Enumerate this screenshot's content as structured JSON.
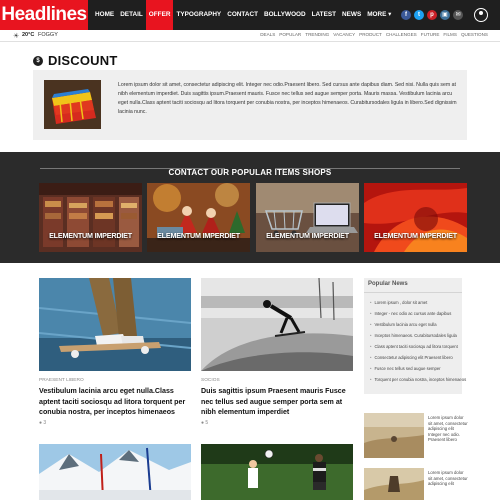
{
  "header": {
    "logo": "Headlines",
    "nav": [
      "HOME",
      "DETAIL",
      "OFFER",
      "TYPOGRAPHY",
      "CONTACT",
      "BOLLYWOOD",
      "LATEST",
      "NEWS",
      "MORE ▾"
    ],
    "active_nav": "OFFER",
    "social": [
      {
        "name": "facebook-icon",
        "glyph": "f",
        "color": "#3b5998"
      },
      {
        "name": "twitter-icon",
        "glyph": "t",
        "color": "#1da1f2"
      },
      {
        "name": "pinterest-icon",
        "glyph": "p",
        "color": "#cb2027"
      },
      {
        "name": "instagram-icon",
        "glyph": "▣",
        "color": "#3f729b"
      },
      {
        "name": "email-icon",
        "glyph": "✉",
        "color": "#555555"
      }
    ]
  },
  "subbar": {
    "temperature": "20°C",
    "condition": "FOGGY",
    "tags": [
      "DEALS",
      "POPULAR",
      "TRENDING",
      "VACANCY",
      "PRODUCT",
      "CHALLENGES",
      "FUTURE",
      "FILMS",
      "QUESTIONS"
    ]
  },
  "discount": {
    "title": "DISCOUNT",
    "text": "Lorem ipsum dolor sit amet, consectetur adipiscing elit. Integer nec odio.Praesent libero. Sed cursus ante dapibus diam. Sed nisi. Nulla quis sem at nibh elementum imperdiet. Duis sagittis ipsum.Praesent mauris. Fusce nec tellus sed augue semper porta. Mauris massa. Vestibulum lacinia arcu eget nulla.Class aptent taciti sociosqu ad litora torquent per conubia nostra, per inceptos himenaeos. Curabitursodales ligula in libero.Sed dignissim lacinia nunc."
  },
  "shops": {
    "title": "CONTACT OUR POPULAR ITEMS SHOPS",
    "cards": [
      "ELEMENTUM IMPERDIET",
      "ELEMENTUM IMPERDIET",
      "ELEMENTUM IMPERDIET",
      "ELEMENTUM IMPERDIET"
    ]
  },
  "posts": [
    {
      "category": "PRAESENT LIBERO",
      "title": "Vestibulum lacinia arcu eget nulla.Class aptent taciti sociosqu ad litora torquent per conubia nostra, per inceptos himenaeos",
      "comments": "3"
    },
    {
      "category": "SOCIOS",
      "title": "Duis sagittis ipsum Praesent mauris Fusce nec tellus sed augue semper porta sem at nibh elementum imperdiet",
      "comments": "5"
    }
  ],
  "popular": {
    "title": "Popular News",
    "items": [
      "Lorem ipsum , dolor sit amet",
      "Integer - nec odio ac cursus ante dapibus",
      "Vestibulum lacinia arcu eget nulla",
      "Inceptos himenaeos. Curabitursodales ligula",
      "Class aptent taciti sociosqu ad litora torquent",
      "Consectetur adipiscing elit Praesent libero",
      "Fusce nec tellus sed augue semper",
      "Torquent per conubia nostra, inceptos himenaeos"
    ],
    "side_items": [
      "Lorem ipsum dolor sit amet, consectetur adipiscing elit Integer nec odio. Praesent libero",
      "Lorem ipsum dolor sit amet, consectetur adipiscing elit"
    ]
  },
  "colors": {
    "brand": "#e8141f",
    "dark": "#1f1f1f",
    "band": "#2b2b2b"
  }
}
